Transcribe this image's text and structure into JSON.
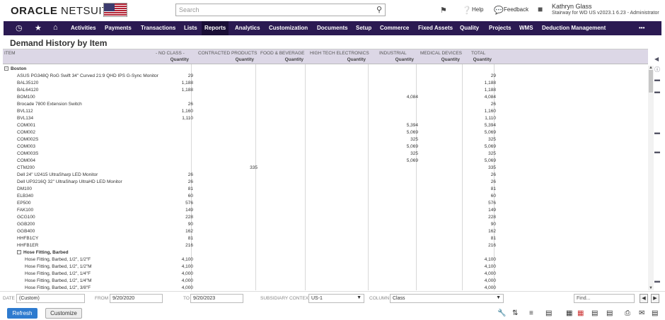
{
  "header": {
    "logo_oracle": "ORACLE",
    "logo_netsuite": " NETSUITE",
    "search_placeholder": "Search",
    "help": "Help",
    "feedback": "Feedback",
    "user_name": "Kathryn Glass",
    "user_role": "Stairway for WD US v2023.1 6.23 - Administrator"
  },
  "nav": {
    "items": [
      "Activities",
      "Payments",
      "Transactions",
      "Lists",
      "Reports",
      "Analytics",
      "Customization",
      "Documents",
      "Setup",
      "Commerce",
      "Fixed Assets",
      "Quality",
      "Projects",
      "WMS",
      "Deduction Management"
    ],
    "active": "Reports",
    "more": "•••"
  },
  "page_title": "Demand History by Item",
  "grid": {
    "headers": [
      "ITEM",
      "- NO CLASS -",
      "CONTRACTED PRODUCTS",
      "FOOD & BEVERAGE",
      "HIGH TECH ELECTRONICS",
      "INDUSTRIAL",
      "MEDICAL DEVICES",
      "TOTAL"
    ],
    "subheader": "Quantity",
    "rows": [
      {
        "name": "Boston",
        "group": true,
        "level": 0
      },
      {
        "name": "ASUS PG348Q RoG Swift 34\" Curved 21:9 QHD IPS G-Sync Monitor",
        "level": 1,
        "noclass": "29",
        "total": "29"
      },
      {
        "name": "BAL35120",
        "level": 1,
        "noclass": "1,188",
        "total": "1,188"
      },
      {
        "name": "BAL64120",
        "level": 1,
        "noclass": "1,188",
        "total": "1,188"
      },
      {
        "name": "BOM100",
        "level": 1,
        "industrial": "4,084",
        "total": "4,084"
      },
      {
        "name": "Brocade 7800 Extension Switch",
        "level": 1,
        "noclass": "26",
        "total": "26"
      },
      {
        "name": "BVL112",
        "level": 1,
        "noclass": "1,160",
        "total": "1,160"
      },
      {
        "name": "BVL134",
        "level": 1,
        "noclass": "1,110",
        "total": "1,110"
      },
      {
        "name": "COM001",
        "level": 1,
        "industrial": "5,394",
        "total": "5,394"
      },
      {
        "name": "COM002",
        "level": 1,
        "industrial": "5,069",
        "total": "5,069"
      },
      {
        "name": "COM002S",
        "level": 1,
        "industrial": "325",
        "total": "325"
      },
      {
        "name": "COM003",
        "level": 1,
        "industrial": "5,069",
        "total": "5,069"
      },
      {
        "name": "COM003S",
        "level": 1,
        "industrial": "325",
        "total": "325"
      },
      {
        "name": "COM004",
        "level": 1,
        "industrial": "5,069",
        "total": "5,069"
      },
      {
        "name": "CTM200",
        "level": 1,
        "contracted": "335",
        "total": "335"
      },
      {
        "name": "Dell 24\" U2415 UltraSharp LED Monitor",
        "level": 1,
        "noclass": "26",
        "total": "26"
      },
      {
        "name": "Dell UP3216Q 32\" UltraSharp UltraHD LED Monitor",
        "level": 1,
        "noclass": "26",
        "total": "26"
      },
      {
        "name": "DM100",
        "level": 1,
        "noclass": "81",
        "total": "81"
      },
      {
        "name": "ELB340",
        "level": 1,
        "noclass": "60",
        "total": "60"
      },
      {
        "name": "EP500",
        "level": 1,
        "noclass": "576",
        "total": "576"
      },
      {
        "name": "FAK100",
        "level": 1,
        "noclass": "149",
        "total": "149"
      },
      {
        "name": "GCG100",
        "level": 1,
        "noclass": "228",
        "total": "228"
      },
      {
        "name": "GGB200",
        "level": 1,
        "noclass": "90",
        "total": "90"
      },
      {
        "name": "GGB400",
        "level": 1,
        "noclass": "162",
        "total": "162"
      },
      {
        "name": "HHFB1CY",
        "level": 1,
        "noclass": "81",
        "total": "81"
      },
      {
        "name": "HHFB1ER",
        "level": 1,
        "noclass": "216",
        "total": "216"
      },
      {
        "name": "Hose Fitting, Barbed",
        "group": true,
        "level": 1
      },
      {
        "name": "Hose Fitting, Barbed, 1/2\", 1/2\"F",
        "level": 2,
        "noclass": "4,100",
        "total": "4,100"
      },
      {
        "name": "Hose Fitting, Barbed, 1/2\", 1/2\"M",
        "level": 2,
        "noclass": "4,100",
        "total": "4,100"
      },
      {
        "name": "Hose Fitting, Barbed, 1/2\", 1/4\"F",
        "level": 2,
        "noclass": "4,000",
        "total": "4,000"
      },
      {
        "name": "Hose Fitting, Barbed, 1/2\", 1/4\"M",
        "level": 2,
        "noclass": "4,000",
        "total": "4,000"
      },
      {
        "name": "Hose Fitting, Barbed, 1/2\", 3/8\"F",
        "level": 2,
        "noclass": "4,000",
        "total": "4,000"
      }
    ]
  },
  "footer": {
    "date_label": "DATE",
    "date_value": "(Custom)",
    "from_label": "FROM",
    "from_value": "9/20/2020",
    "to_label": "TO",
    "to_value": "9/20/2023",
    "subsidiary_label": "SUBSIDIARY CONTEXT",
    "subsidiary_value": "US-1",
    "column_label": "COLUMN",
    "column_value": "Class",
    "find_placeholder": "Find...",
    "refresh": "Refresh",
    "customize": "Customize"
  }
}
